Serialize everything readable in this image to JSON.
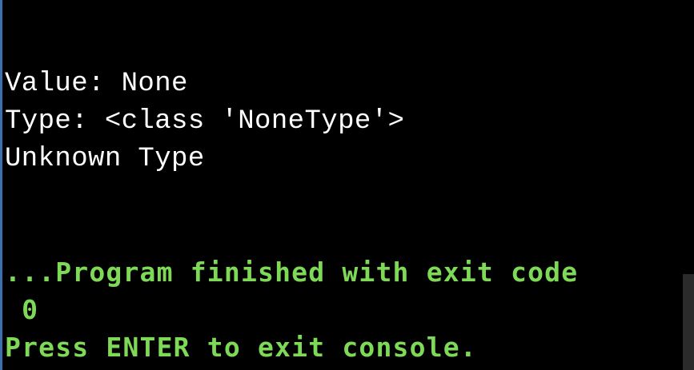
{
  "console": {
    "output_lines": [
      "Value: None",
      "Type: <class 'NoneType'>",
      "Unknown Type"
    ],
    "status_lines": [
      "...Program finished with exit code",
      " 0",
      "Press ENTER to exit console."
    ]
  },
  "colors": {
    "background": "#000000",
    "output_text": "#ffffff",
    "status_text": "#7ed957",
    "window_edge": "#3b6fb0",
    "scrollbar_thumb": "#2b2b2b"
  }
}
